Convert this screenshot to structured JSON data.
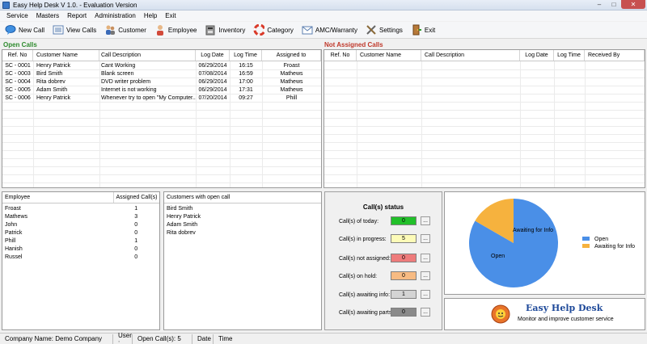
{
  "window": {
    "title": "Easy Help Desk V 1.0. - Evaluation Version",
    "minimize": "–",
    "maximize": "□",
    "close": "✕"
  },
  "menu": [
    "Service",
    "Masters",
    "Report",
    "Administration",
    "Help",
    "Exit"
  ],
  "toolbar": [
    {
      "label": "New Call",
      "icon": "new-call-icon"
    },
    {
      "label": "View Calls",
      "icon": "view-calls-icon"
    },
    {
      "label": "Customer",
      "icon": "customer-icon"
    },
    {
      "label": "Employee",
      "icon": "employee-icon"
    },
    {
      "label": "Inventory",
      "icon": "inventory-icon"
    },
    {
      "label": "Category",
      "icon": "category-icon"
    },
    {
      "label": "AMC/Warranty",
      "icon": "amc-warranty-icon"
    },
    {
      "label": "Settings",
      "icon": "settings-icon"
    },
    {
      "label": "Exit",
      "icon": "exit-icon"
    }
  ],
  "open_calls": {
    "title": "Open Calls",
    "columns": [
      "Ref. No",
      "Customer Name",
      "Call Description",
      "Log Date",
      "Log Time",
      "Assigned to"
    ],
    "rows": [
      [
        "SC - 0001",
        "Henry Patrick",
        "Cant Working",
        "06/29/2014",
        "16:15",
        "Froast"
      ],
      [
        "SC - 0003",
        "Bird Smith",
        "Blank screen",
        "07/08/2014",
        "16:59",
        "Mathews"
      ],
      [
        "SC - 0004",
        "Rita dobrev",
        "DVD writer problem",
        "06/29/2014",
        "17:00",
        "Mathews"
      ],
      [
        "SC - 0005",
        "Adam Smith",
        "Internet is not working",
        "06/29/2014",
        "17:31",
        "Mathews"
      ],
      [
        "SC - 0006",
        "Henry Patrick",
        "Whenever try to open \"My Computer...",
        "07/20/2014",
        "09:27",
        "Phill"
      ]
    ]
  },
  "not_assigned": {
    "title": "Not Assigned Calls",
    "columns": [
      "Ref. No",
      "Customer Name",
      "Call Description",
      "Log Date",
      "Log Time",
      "Received By"
    ]
  },
  "employees": {
    "columns": [
      "Employee",
      "Assigned Call(s)"
    ],
    "rows": [
      [
        "Froast",
        "1"
      ],
      [
        "Mathews",
        "3"
      ],
      [
        "John",
        "0"
      ],
      [
        "Patrick",
        "0"
      ],
      [
        "Phill",
        "1"
      ],
      [
        "Hanish",
        "0"
      ],
      [
        "Russel",
        "0"
      ]
    ]
  },
  "customers_open": {
    "column": "Customers  with open call",
    "rows": [
      "Bird Smith",
      "Henry Patrick",
      "Adam Smith",
      "Rita dobrev"
    ]
  },
  "status": {
    "title": "Call(s) status",
    "items": [
      {
        "label": "Call(s) of today:",
        "value": "0",
        "color": "#22c02a"
      },
      {
        "label": "Call(s) in progress:",
        "value": "5",
        "color": "#fdfbb8"
      },
      {
        "label": "Call(s) not assigned:",
        "value": "0",
        "color": "#ee7b7b"
      },
      {
        "label": "Call(s) on hold:",
        "value": "0",
        "color": "#f7bb83"
      },
      {
        "label": "Call(s) awaiting info:",
        "value": "1",
        "color": "#d4d4d4"
      },
      {
        "label": "Call(s) awaiting parts:",
        "value": "0",
        "color": "#8a8a8a"
      }
    ],
    "button_label": "..."
  },
  "chart_data": {
    "type": "pie",
    "categories": [
      "Open",
      "Awaiting for Info"
    ],
    "values": [
      5,
      1
    ],
    "colors": [
      "#4a8fe7",
      "#f6b23e"
    ],
    "legend": "right"
  },
  "brand": {
    "name": "Easy Help Desk",
    "tagline": "Monitor and improve customer service"
  },
  "statusbar": {
    "company": "Company Name: Demo Company",
    "user": "User :",
    "open_calls": "Open Call(s): 5",
    "date": "Date",
    "time": "Time"
  }
}
